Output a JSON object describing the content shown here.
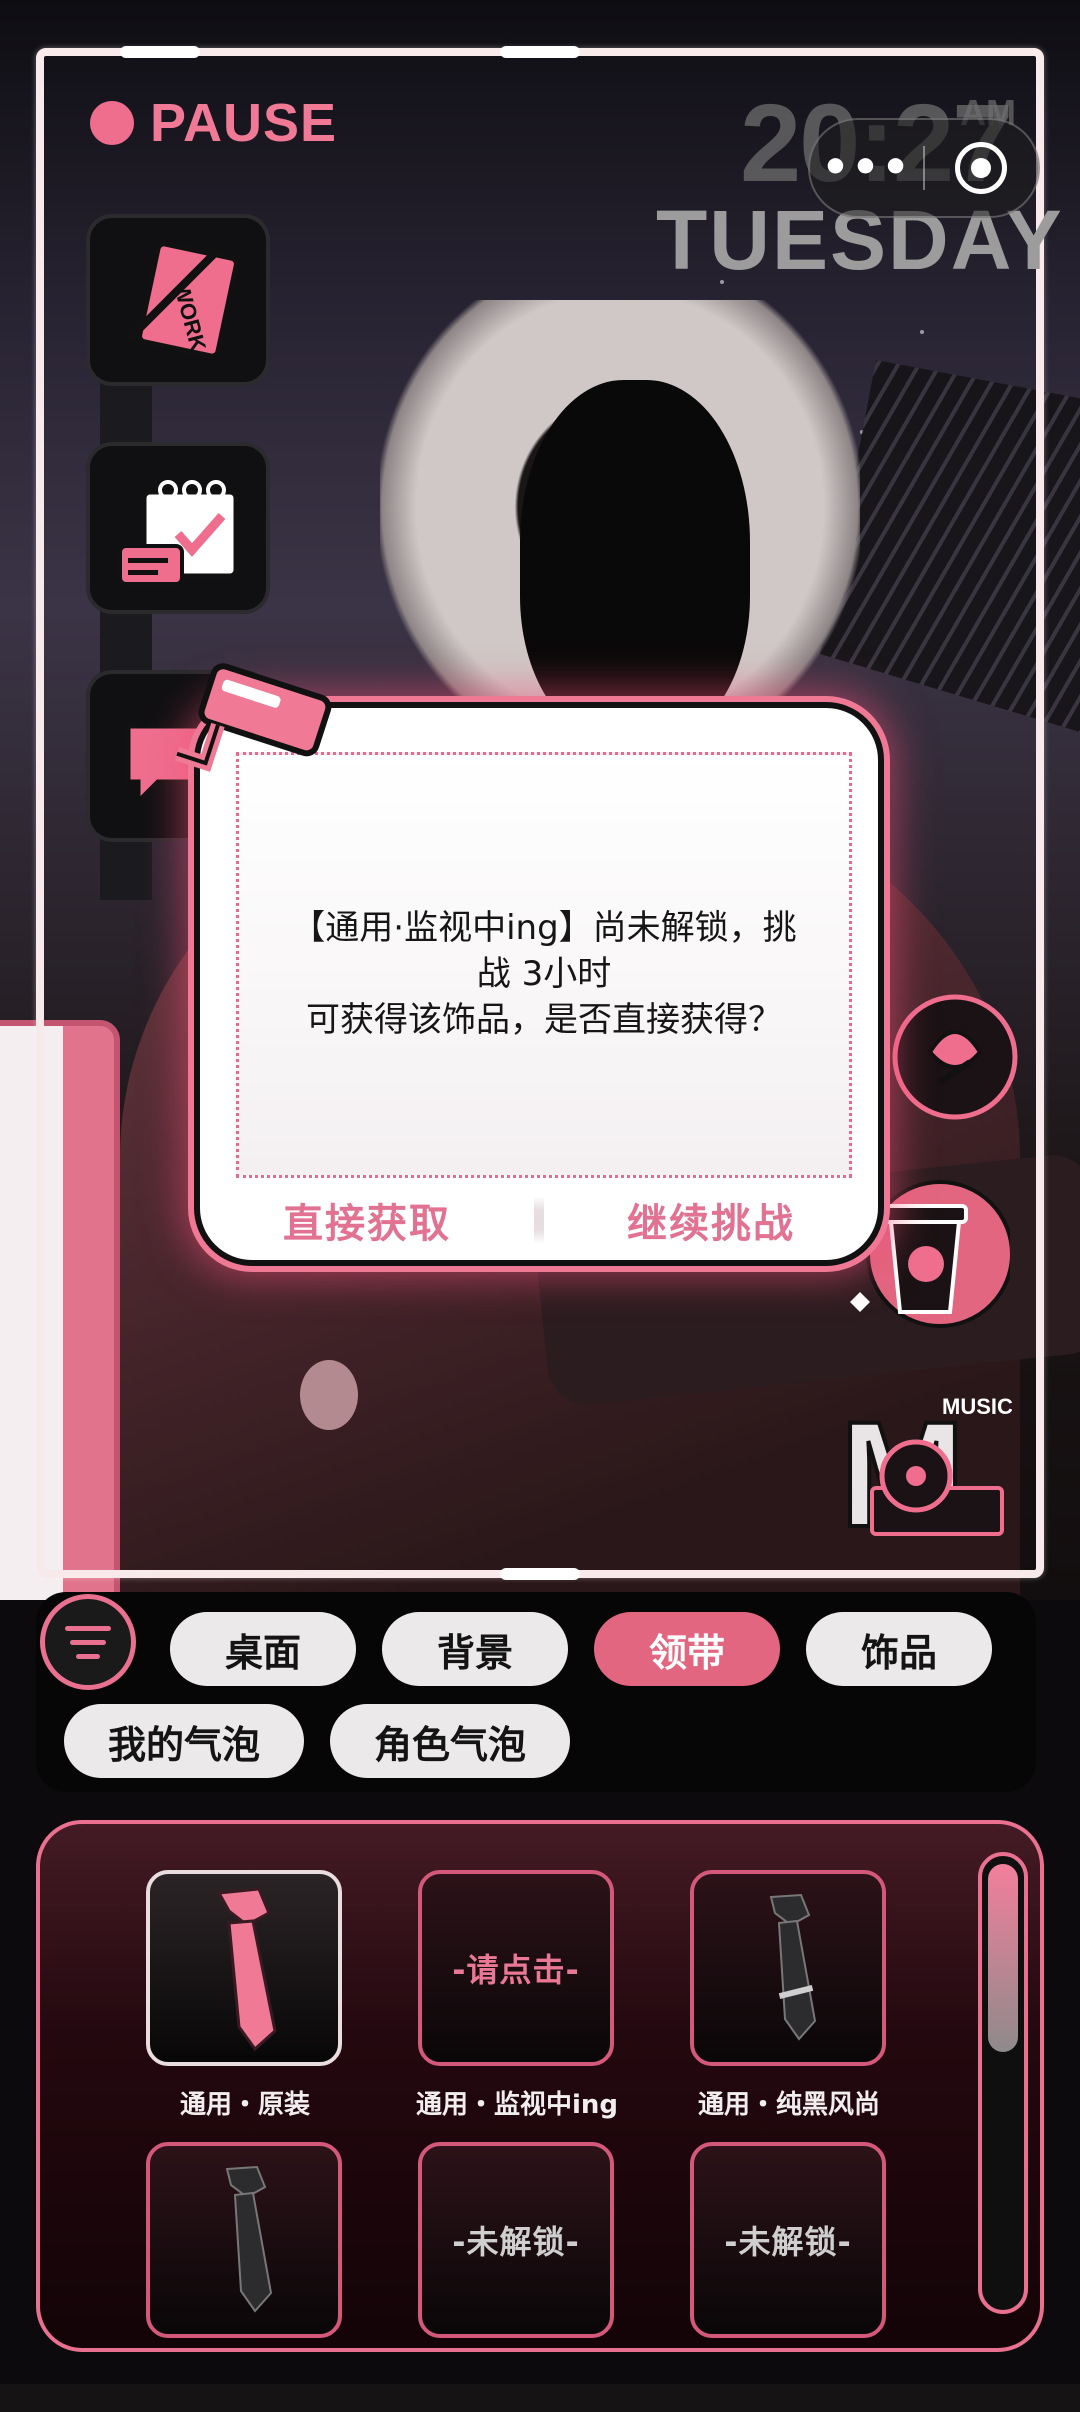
{
  "status": {
    "pause_label": "PAUSE"
  },
  "clock": {
    "time": "20:27",
    "ampm": "AM",
    "weekday": "TUESDAY"
  },
  "capsule": {
    "more_label": "•••",
    "close_icon": "target-circle-icon"
  },
  "side_apps": [
    {
      "name": "work-notebook-icon"
    },
    {
      "name": "calendar-check-icon"
    },
    {
      "name": "chat-bubble-icon"
    }
  ],
  "right_apps": [
    {
      "name": "rose-icon"
    },
    {
      "name": "coffee-cup-icon"
    },
    {
      "name": "music-player-icon",
      "label": "MUSIC"
    }
  ],
  "dialog": {
    "line1": "【通用·监视中ing】尚未解锁，挑",
    "line2": "战 3小时",
    "line3": "可获得该饰品，是否直接获得？",
    "confirm_label": "直接获取",
    "continue_label": "继续挑战"
  },
  "tabs": [
    {
      "label": "桌面",
      "active": false
    },
    {
      "label": "背景",
      "active": false
    },
    {
      "label": "领带",
      "active": true
    },
    {
      "label": "饰品",
      "active": false
    },
    {
      "label": "我的气泡",
      "active": false
    },
    {
      "label": "角色气泡",
      "active": false
    }
  ],
  "items": [
    {
      "caption": "通用・原装",
      "overlay": "",
      "selected": true,
      "color": "#f07a96"
    },
    {
      "caption": "通用・监视中ing",
      "overlay": "-请点击-",
      "selected": false,
      "color": "#1a1a1a"
    },
    {
      "caption": "通用・纯黑风尚",
      "overlay": "",
      "selected": false,
      "color": "#2a2a2a"
    },
    {
      "caption": "",
      "overlay": "",
      "selected": false,
      "color": "#2a2a2a"
    },
    {
      "caption": "",
      "overlay": "-未解锁-",
      "selected": false,
      "color": "#1a1a1a"
    },
    {
      "caption": "",
      "overlay": "-未解锁-",
      "selected": false,
      "color": "#1a1a1a"
    }
  ],
  "colors": {
    "accent": "#e9718f",
    "active_tab": "#e26680",
    "frame": "#f8eaea"
  }
}
